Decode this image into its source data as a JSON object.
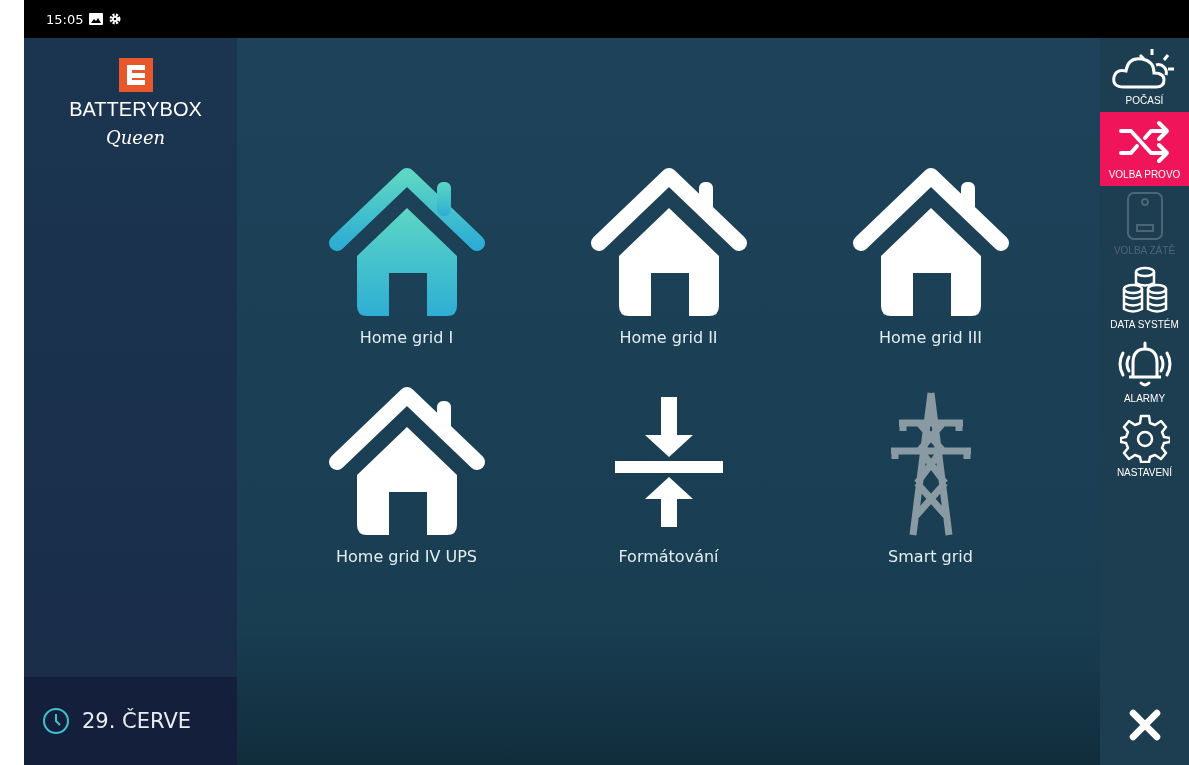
{
  "status_bar": {
    "time": "15:05"
  },
  "brand": {
    "name_bold": "BATTERY",
    "name_light": "BOX",
    "subtitle": "Queen"
  },
  "modes": [
    {
      "label": "Home grid I",
      "kind": "house",
      "selected": true
    },
    {
      "label": "Home grid II",
      "kind": "house",
      "selected": false
    },
    {
      "label": "Home grid III",
      "kind": "house",
      "selected": false
    },
    {
      "label": "Home grid IV UPS",
      "kind": "house",
      "selected": false
    },
    {
      "label": "Formátování",
      "kind": "compress",
      "selected": false
    },
    {
      "label": "Smart grid",
      "kind": "pylon",
      "selected": false
    }
  ],
  "sidebar": {
    "items": [
      {
        "label": "POČASÍ",
        "kind": "weather",
        "selected": false,
        "disabled": false
      },
      {
        "label": "VOLBA PROVO",
        "kind": "shuffle",
        "selected": true,
        "disabled": false
      },
      {
        "label": "VOLBA ZÁTĚ",
        "kind": "boiler",
        "selected": false,
        "disabled": true
      },
      {
        "label": "DATA SYSTÉM",
        "kind": "data",
        "selected": false,
        "disabled": false
      },
      {
        "label": "ALARMY",
        "kind": "alarm",
        "selected": false,
        "disabled": false
      },
      {
        "label": "NASTAVENÍ",
        "kind": "settings",
        "selected": false,
        "disabled": false
      }
    ]
  },
  "bottom_bar": {
    "date": "29. ČERVE"
  }
}
